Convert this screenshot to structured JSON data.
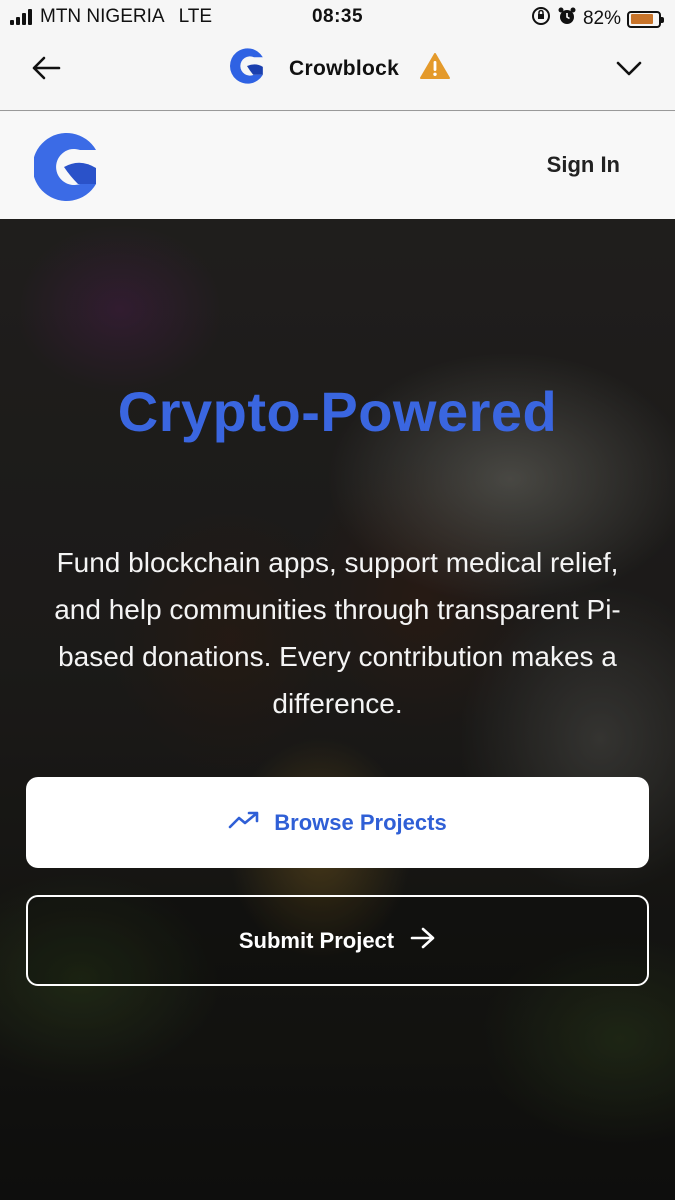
{
  "status_bar": {
    "carrier": "MTN NIGERIA",
    "network": "LTE",
    "time": "08:35",
    "battery": "82%",
    "battery_level": 0.82,
    "battery_color": "#c8742a"
  },
  "browser_bar": {
    "site_name": "Crowblock",
    "back_icon": "back-arrow-icon",
    "warning_icon": "warning-icon",
    "menu_icon": "chevron-down-icon"
  },
  "site_header": {
    "sign_in": "Sign In",
    "brand_color": "#3b6be6"
  },
  "hero": {
    "headline": "Crypto-Powered",
    "subtitle": "Fund blockchain apps, support medical relief, and help communities through transparent Pi-based donations. Every contribution makes a difference.",
    "browse_button": "Browse Projects",
    "submit_button": "Submit Project",
    "accent_color": "#3a66e0"
  }
}
